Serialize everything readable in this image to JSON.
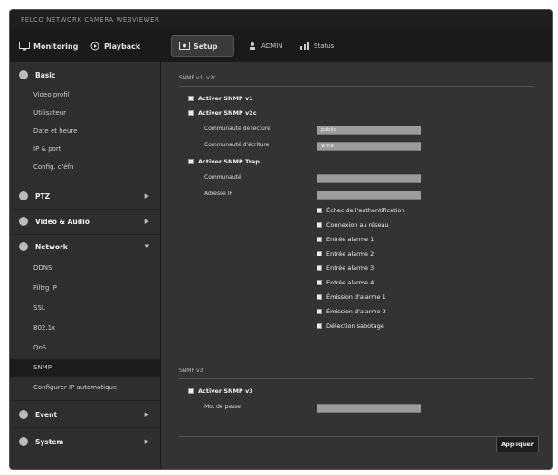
{
  "window": {
    "title": "PELCO NETWORK CAMERA WEBVIEWER"
  },
  "nav": {
    "monitoring": "Monitoring",
    "playback": "Playback",
    "setup": "Setup",
    "admin": "ADMIN",
    "status": "Status"
  },
  "sidebar": {
    "basic": "Basic",
    "basic_items": [
      "Video profil",
      "Utilisateur",
      "Date et heure",
      "IP & port",
      "Config. d'éfn"
    ],
    "ptz": "PTZ",
    "video_audio": "Video & Audio",
    "network": "Network",
    "network_items": [
      "DDNS",
      "Filtrg IP",
      "SSL",
      "802.1x",
      "QoS",
      "SNMP",
      "Configurer IP automatique"
    ],
    "event": "Event",
    "system": "System"
  },
  "snmp12": {
    "section_title": "SNMP v1, v2c",
    "enable_v1": "Activer SNMP v1",
    "enable_v2c": "Activer SNMP v2c",
    "read_community": "Communauté de lecture",
    "read_community_value": "public",
    "write_community": "Communauté d'écriture",
    "write_community_value": "write",
    "enable_trap": "Activer SNMP Trap",
    "trap_community": "Communauté",
    "trap_ip": "Adresse IP",
    "trap_options": [
      "Échec de l'authentification",
      "Connexion au réseau",
      "Entrée alarme 1",
      "Entrée alarme 2",
      "Entrée alarme 3",
      "Entrée alarme 4",
      "Émission d'alarme 1",
      "Émission d'alarme 2",
      "Détection sabotage"
    ]
  },
  "snmp3": {
    "section_title": "SNMP v3",
    "enable_v3": "Activer SNMP v3",
    "password": "Mot de passe"
  },
  "apply_label": "Appliquer"
}
